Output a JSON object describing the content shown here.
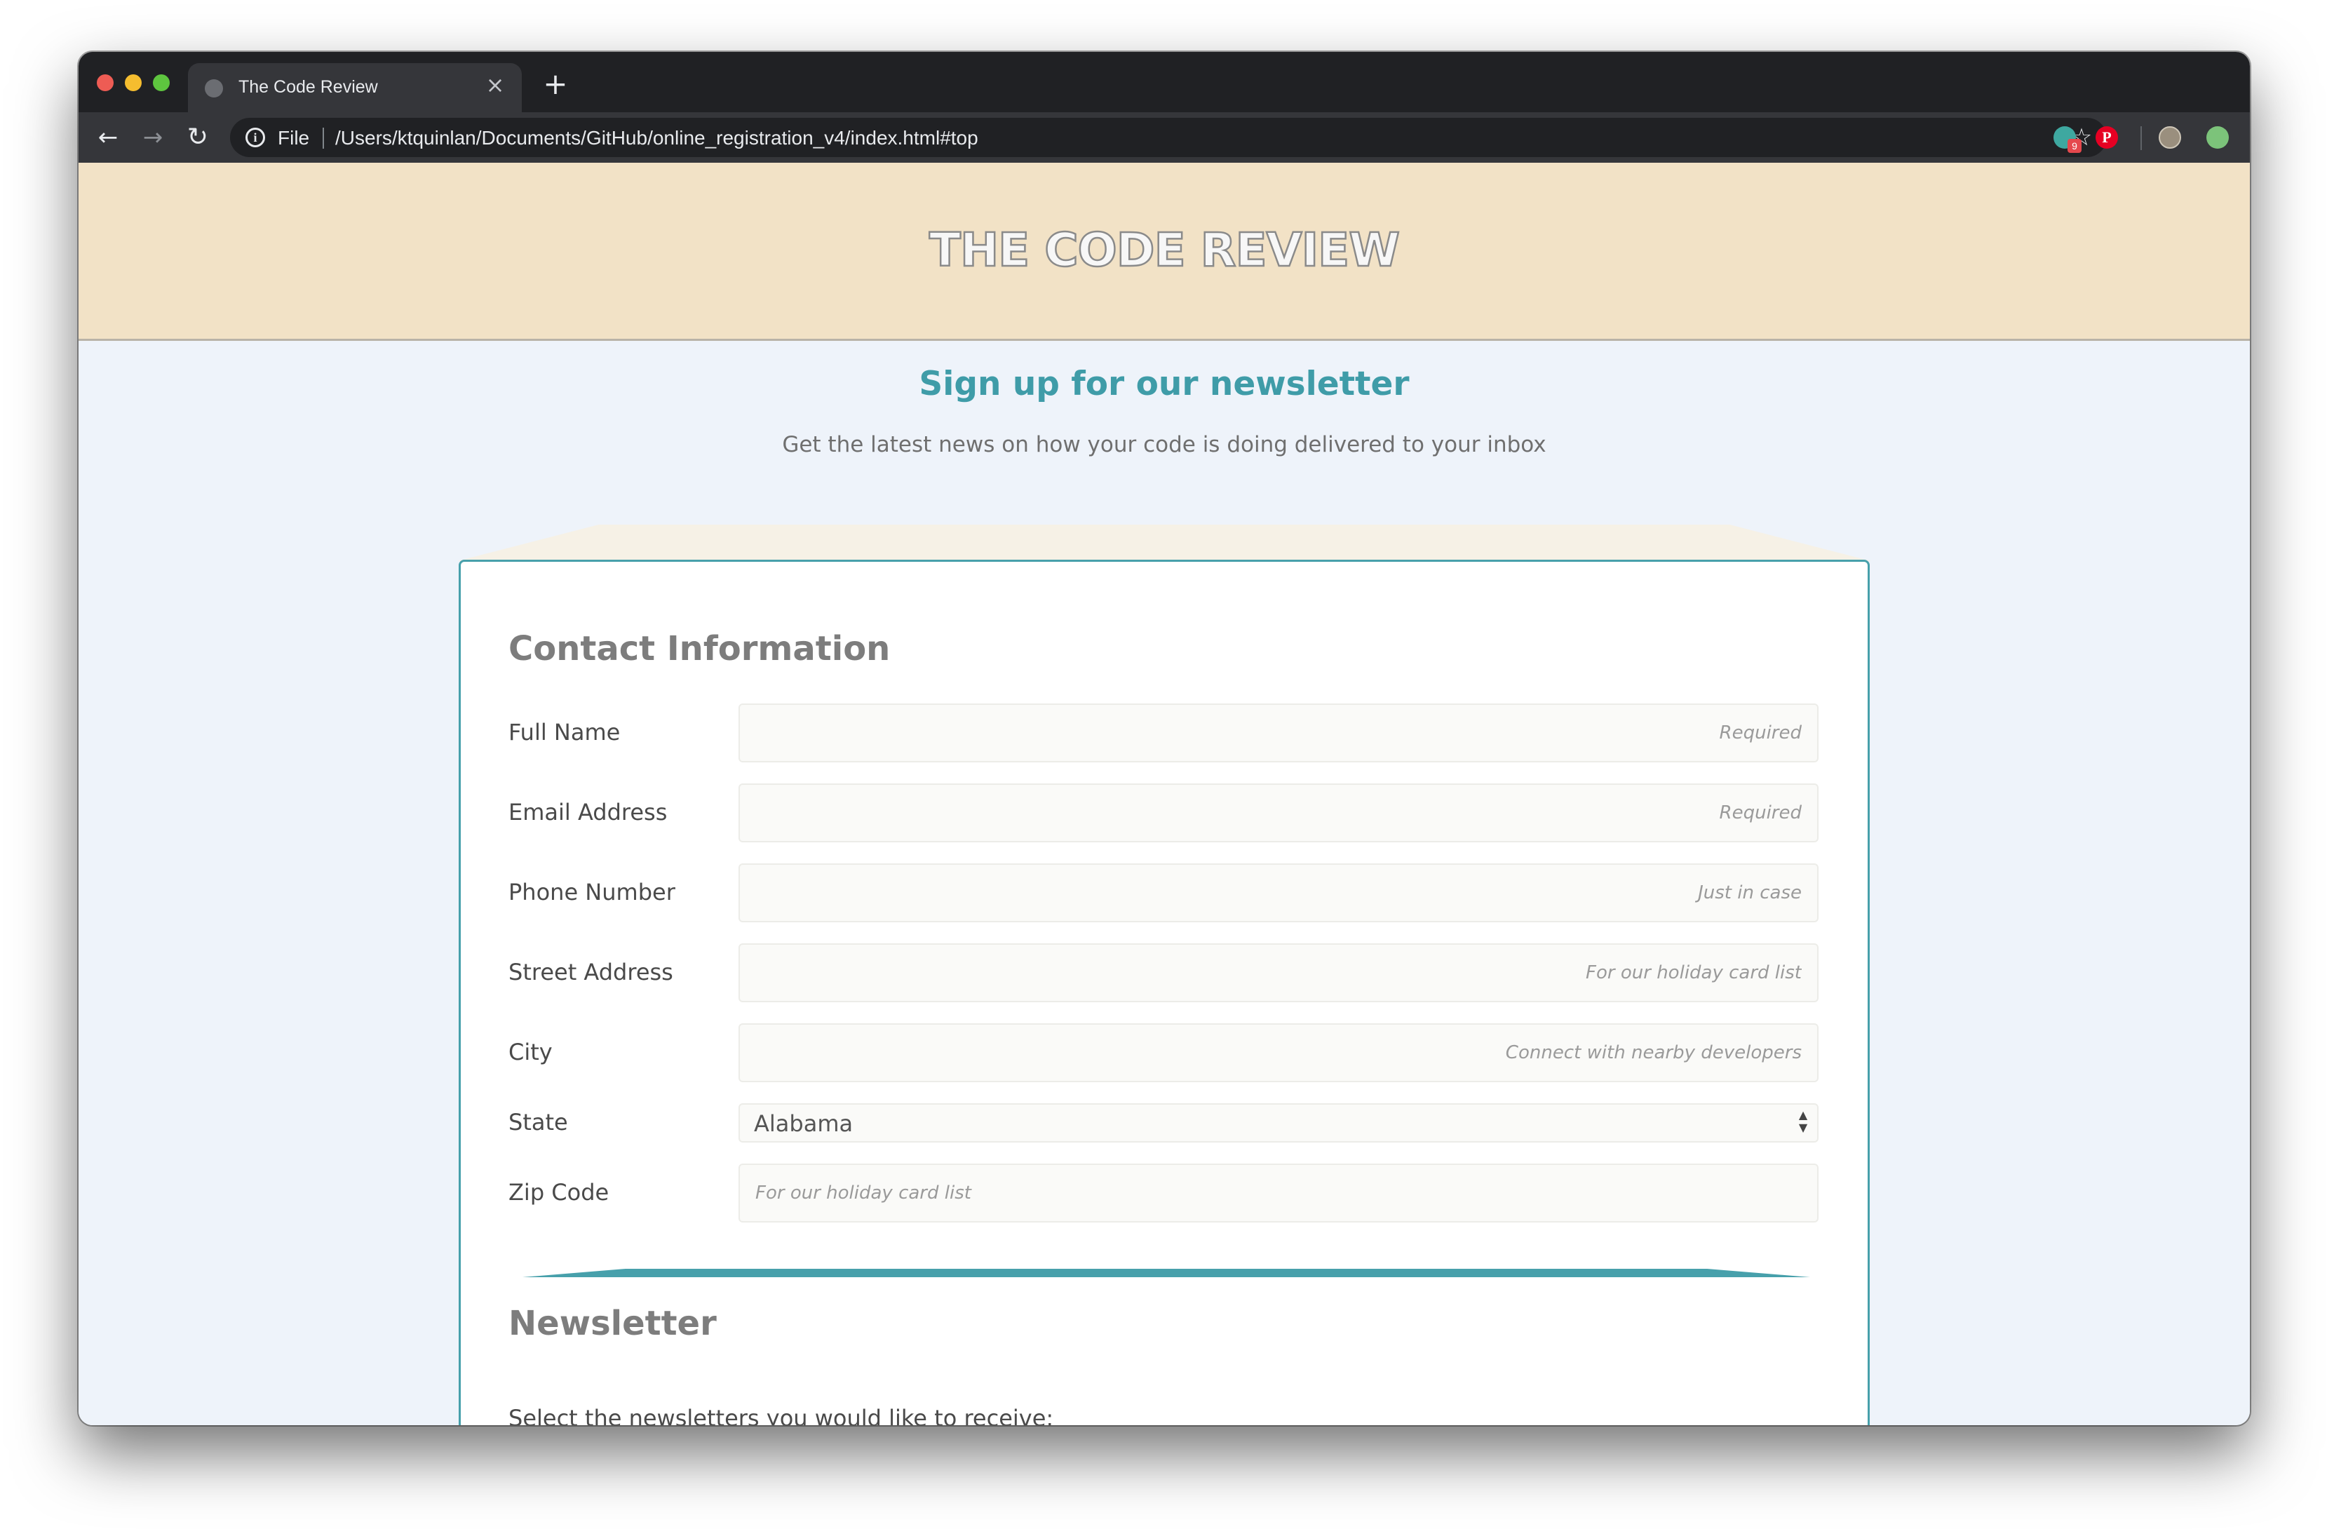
{
  "browser": {
    "tab_title": "The Code Review",
    "tab_close": "×",
    "new_tab": "+",
    "back": "←",
    "forward": "→",
    "reload": "↻",
    "scheme_label": "File",
    "url": "/Users/ktquinlan/Documents/GitHub/online_registration_v4/index.html#top",
    "bookmark_icon": "☆",
    "extensions": [
      {
        "name": "grammarly-icon",
        "badge": "9",
        "color": "#3ea8a0"
      },
      {
        "name": "pinterest-icon",
        "glyph": "P",
        "color": "#e60023"
      },
      {
        "name": "profile-avatar-icon",
        "color": "#9a8f7e"
      },
      {
        "name": "update-icon",
        "color": "#7cc37a"
      }
    ]
  },
  "site": {
    "title": "THE CODE REVIEW",
    "header_color": "#f2e2c6",
    "accent_color": "#47a0ab"
  },
  "hero": {
    "heading": "Sign up for our newsletter",
    "subheading": "Get the latest news on how your code is doing delivered to your inbox"
  },
  "contact": {
    "heading": "Contact Information",
    "fields": {
      "full_name": {
        "label": "Full Name",
        "placeholder": "Required"
      },
      "email": {
        "label": "Email Address",
        "placeholder": "Required"
      },
      "phone": {
        "label": "Phone Number",
        "placeholder": "Just in case"
      },
      "street": {
        "label": "Street Address",
        "placeholder": "For our holiday card list"
      },
      "city": {
        "label": "City",
        "placeholder": "Connect with nearby developers"
      },
      "state": {
        "label": "State",
        "value": "Alabama"
      },
      "zip": {
        "label": "Zip Code",
        "placeholder": "For our holiday card list"
      }
    }
  },
  "newsletter": {
    "heading": "Newsletter",
    "intro": "Select the newsletters you would like to receive:"
  }
}
